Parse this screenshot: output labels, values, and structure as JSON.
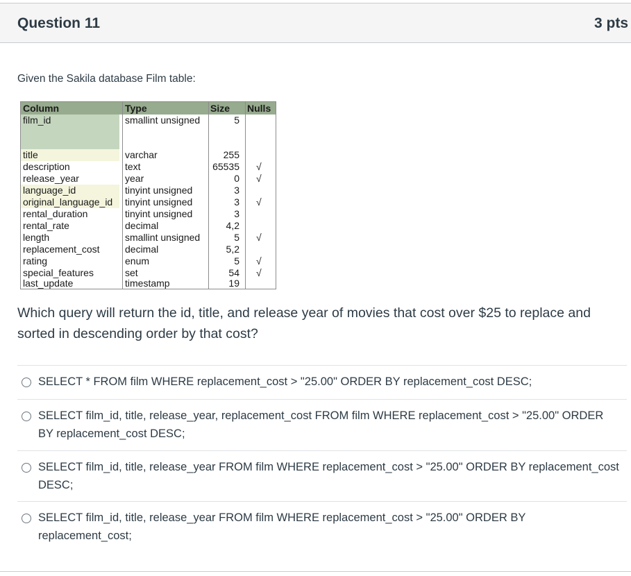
{
  "header": {
    "title": "Question 11",
    "points": "3 pts"
  },
  "intro": "Given the Sakila database Film table:",
  "schema_table": {
    "headers": [
      "Column",
      "Type",
      "Size",
      "Nulls"
    ],
    "rows": [
      {
        "column": "film_id",
        "type": "smallint unsigned",
        "size": "5",
        "nulls": ""
      },
      {
        "column": "title",
        "type": "varchar",
        "size": "255",
        "nulls": ""
      },
      {
        "column": "description",
        "type": "text",
        "size": "65535",
        "nulls": "√"
      },
      {
        "column": "release_year",
        "type": "year",
        "size": "0",
        "nulls": "√"
      },
      {
        "column": "language_id",
        "type": "tinyint unsigned",
        "size": "3",
        "nulls": ""
      },
      {
        "column": "original_language_id",
        "type": "tinyint unsigned",
        "size": "3",
        "nulls": "√"
      },
      {
        "column": "rental_duration",
        "type": "tinyint unsigned",
        "size": "3",
        "nulls": ""
      },
      {
        "column": "rental_rate",
        "type": "decimal",
        "size": "4,2",
        "nulls": ""
      },
      {
        "column": "length",
        "type": "smallint unsigned",
        "size": "5",
        "nulls": "√"
      },
      {
        "column": "replacement_cost",
        "type": "decimal",
        "size": "5,2",
        "nulls": ""
      },
      {
        "column": "rating",
        "type": "enum",
        "size": "5",
        "nulls": "√"
      },
      {
        "column": "special_features",
        "type": "set",
        "size": "54",
        "nulls": "√"
      },
      {
        "column": "last_update",
        "type": "timestamp",
        "size": "19",
        "nulls": ""
      }
    ]
  },
  "question": "Which query will return the id, title, and release year of movies that cost over $25 to replace and sorted in descending order by that cost?",
  "answers": [
    "SELECT * FROM film WHERE replacement_cost > \"25.00\" ORDER BY replacement_cost DESC;",
    "SELECT film_id, title, release_year, replacement_cost FROM film WHERE replacement_cost > \"25.00\" ORDER BY replacement_cost DESC;",
    "SELECT film_id, title, release_year FROM film WHERE replacement_cost > \"25.00\" ORDER BY replacement_cost DESC;",
    "SELECT film_id, title, release_year FROM film WHERE replacement_cost > \"25.00\" ORDER BY replacement_cost;"
  ]
}
